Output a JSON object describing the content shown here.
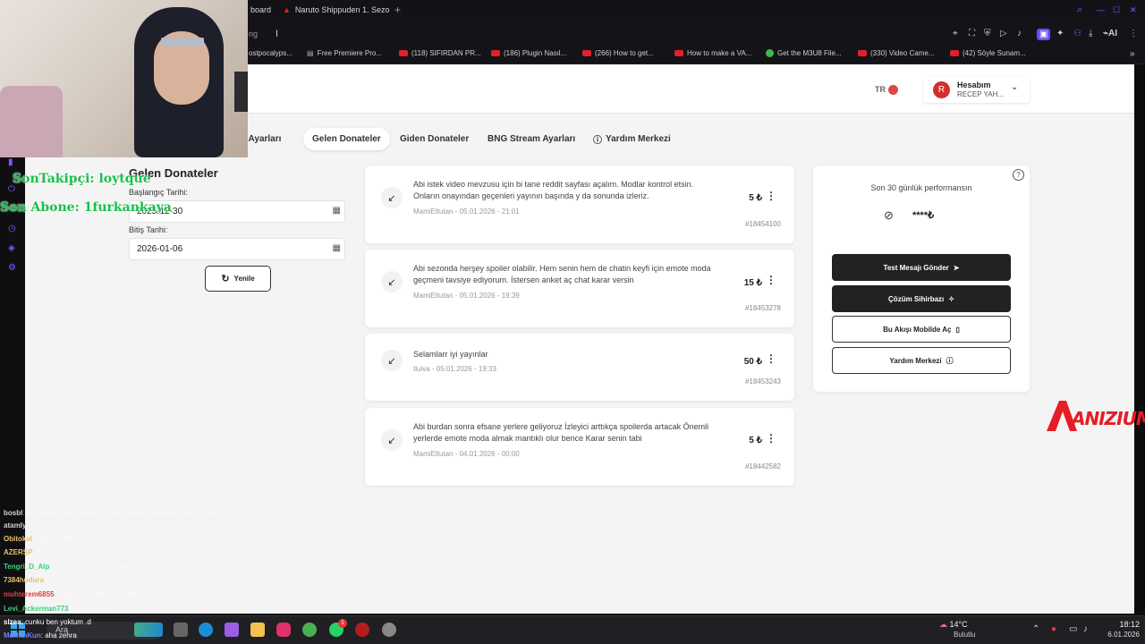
{
  "browser": {
    "tabs": [
      {
        "label": "board"
      },
      {
        "label": "Naruto Shippuden 1. Sezo"
      }
    ],
    "address_text": "ng",
    "bookmarks": [
      "ostpocalyps...",
      "Free Premiere Pro...",
      "(118) SIFIRDAN PR...",
      "(186) Plugin Nasıl...",
      "(266) How to get...",
      "How to make a VA...",
      "Get the M3U8 File...",
      "(330) Video Came...",
      "(42) Söyle Sunam..."
    ],
    "ai_label": "AI"
  },
  "header": {
    "language": "TR",
    "avatar_letter": "R",
    "account_label": "Hesabım",
    "account_name": "RECEP YAH..."
  },
  "tabs": {
    "partial": "ıcı Ayarları",
    "incoming": "Gelen Donateler",
    "outgoing": "Giden Donateler",
    "stream": "BNG Stream Ayarları",
    "help": "Yardım Merkezi"
  },
  "filter": {
    "title": "Gelen Donateler",
    "start_label": "Başlangıç Tarihi:",
    "start_value": "2025-12-30",
    "end_label": "Bitiş Tarihi:",
    "end_value": "2026-01-06",
    "refresh_label": "Yenile"
  },
  "donations": [
    {
      "text": "Abi istek video mevzusu için bi tane reddit sayfası açalım. Modlar kontrol etsin. Onların onayından geçenleri yayının başında y da sonunda izleriz.",
      "meta": "MamiEltutan - 05.01.2026 - 21:01",
      "amount": "5 ₺",
      "id": "#18454100"
    },
    {
      "text": "Abi sezonda herşey spoiler olabilir. Hem senin hem de chatin keyfi için emote moda geçmeni tavsiye ediyorum. İstersen anket aç chat karar versin",
      "meta": "MamiEltutan - 05.01.2026 - 19:39",
      "amount": "15 ₺",
      "id": "#18453278"
    },
    {
      "text": "Selamlarr iyi yayınlar",
      "meta": "Iluiva - 05.01.2026 - 19:33",
      "amount": "50 ₺",
      "id": "#18453243"
    },
    {
      "text": "Abi burdan sonra efsane yerlere geliyoruz İzleyici arttıkça spoilerda artacak Önemli yerlerde emote moda almak mantıklı olur bence Karar senin tabi",
      "meta": "MamiEltutan - 04.01.2026 - 00:00",
      "amount": "5 ₺",
      "id": "#18442582"
    }
  ],
  "performance": {
    "title": "Son 30 günlük performansın",
    "hidden_value": "****₺",
    "test_button": "Test Mesajı Gönder",
    "wizard_button": "Çözüm Sihirbazı",
    "mobile_button": "Bu Akışı Mobilde Aç",
    "help_button": "Yardım Merkezi"
  },
  "overlay": {
    "follower": "SonTakipçi: loytque",
    "subscriber": "Son Abone: 1furkankaya",
    "logo": "ANIZIUM"
  },
  "chat": [
    {
      "user": "bosbl",
      "msg": ": abi emote moda olmayin emote modu kapatmas bile mecaz",
      "color": "#d0d0d0"
    },
    {
      "user": "atamly",
      "msg": "",
      "color": "#d0d0d0"
    },
    {
      "user": "Obitokal",
      "msg": ": yukarı OBİTO yazıldı",
      "color": "#e8c06a"
    },
    {
      "user": "AZERSP",
      "msg": ": Ek acer nasıl video atıyon",
      "color": "#e8c06a"
    },
    {
      "user": "Tengri_D_Alp",
      "msg": ": @lcvnyly viduo son pkm",
      "color": "#3fd07a"
    },
    {
      "user": "7384hudura",
      "msg": ": n",
      "color": "#e8c06a"
    },
    {
      "user": "muhterem6855",
      "msg": ": dükkü chat full tekrik yetek vach",
      "color": "#e04040"
    },
    {
      "user": "Levi_Ackerman773",
      "msg": ": Ek efsanon",
      "color": "#3fd07a"
    },
    {
      "user": "slzea",
      "msg": ": cunku ben yoktum .d",
      "color": "#ffffff"
    },
    {
      "user": "MerhinKun",
      "msg": ": aha zehra",
      "color": "#7c7cff"
    }
  ],
  "taskbar": {
    "search_placeholder": "Ara",
    "weather_temp": "14°C",
    "weather_desc": "Bulutlu",
    "time": "18:12",
    "date": "6.01.2026",
    "notification_count": "1"
  },
  "colors": {
    "dark_button": "#222222",
    "accent_red": "#d32f2f",
    "page_bg": "#f4f4f5"
  }
}
